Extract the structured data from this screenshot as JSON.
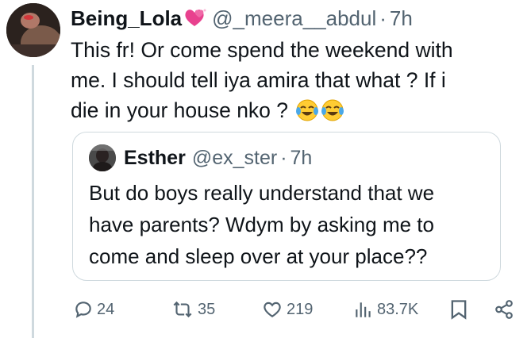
{
  "author": {
    "display_name": "Being_Lola",
    "handle": "@_meera__abdul",
    "separator": "·",
    "time": "7h",
    "name_emoji": "heart-icon"
  },
  "tweet": {
    "lines": [
      "This fr! Or come spend the weekend with",
      "me. I should tell iya amira that what ? If i",
      "die in your house nko ?"
    ],
    "trailing_emoji": [
      "tears-of-joy-emoji",
      "tears-of-joy-emoji"
    ]
  },
  "quote": {
    "display_name": "Esther",
    "handle": "@ex_ster",
    "separator": "·",
    "time": "7h",
    "lines": [
      "But do boys really understand that we",
      "have parents? Wdym by asking me to",
      "come and sleep over at your place??"
    ]
  },
  "actions": {
    "replies": "24",
    "reposts": "35",
    "likes": "219",
    "views": "83.7K"
  },
  "colors": {
    "text": "#0f1419",
    "secondary": "#536471",
    "border": "#cfd9de",
    "heart": "#e8418e"
  }
}
